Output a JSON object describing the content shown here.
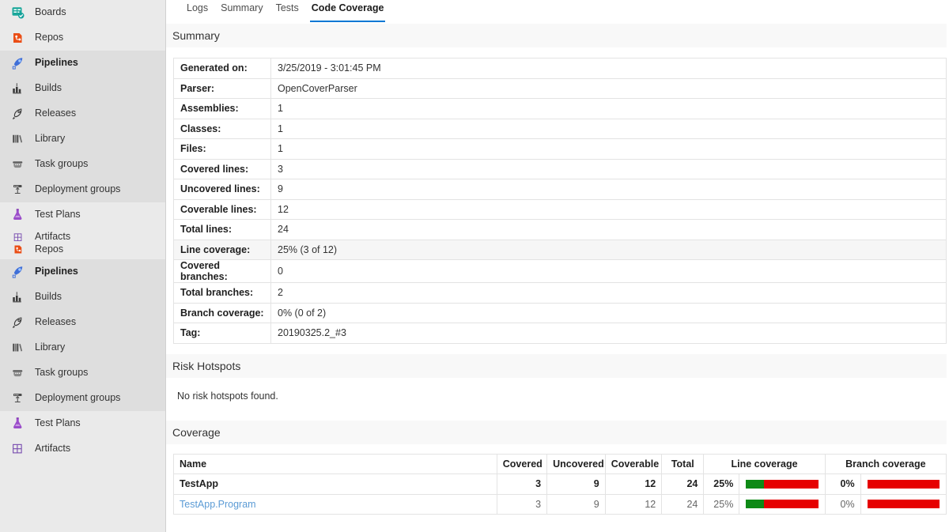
{
  "sidebar": {
    "groups": [
      {
        "active": false,
        "items": [
          {
            "label": "Boards",
            "icon": "boards-icon",
            "bold": false,
            "two_line": false
          }
        ]
      },
      {
        "active": false,
        "items": [
          {
            "label": "Repos",
            "icon": "repos-icon",
            "bold": false,
            "two_line": false
          }
        ]
      },
      {
        "active": true,
        "items": [
          {
            "label": "Pipelines",
            "icon": "pipelines-icon",
            "bold": true,
            "two_line": false
          },
          {
            "label": "Builds",
            "icon": "builds-icon",
            "bold": false,
            "two_line": false
          },
          {
            "label": "Releases",
            "icon": "releases-icon",
            "bold": false,
            "two_line": false
          },
          {
            "label": "Library",
            "icon": "library-icon",
            "bold": false,
            "two_line": false
          },
          {
            "label": "Task groups",
            "icon": "task-groups-icon",
            "bold": false,
            "two_line": false
          },
          {
            "label": "Deployment groups",
            "icon": "deployment-groups-icon",
            "bold": false,
            "two_line": false
          }
        ]
      },
      {
        "active": false,
        "items": [
          {
            "label": "Test Plans",
            "icon": "test-plans-icon",
            "bold": false,
            "two_line": false
          },
          {
            "label": "Artifacts\nRepos",
            "icon": "artifacts-repos-icon",
            "bold": false,
            "two_line": true
          }
        ]
      },
      {
        "active": true,
        "items": [
          {
            "label": "Pipelines",
            "icon": "pipelines-icon",
            "bold": true,
            "two_line": false
          },
          {
            "label": "Builds",
            "icon": "builds-icon",
            "bold": false,
            "two_line": false
          },
          {
            "label": "Releases",
            "icon": "releases-icon",
            "bold": false,
            "two_line": false
          },
          {
            "label": "Library",
            "icon": "library-icon",
            "bold": false,
            "two_line": false
          },
          {
            "label": "Task groups",
            "icon": "task-groups-icon",
            "bold": false,
            "two_line": false
          },
          {
            "label": "Deployment groups",
            "icon": "deployment-groups-icon",
            "bold": false,
            "two_line": false
          }
        ]
      },
      {
        "active": false,
        "items": [
          {
            "label": "Test Plans",
            "icon": "test-plans-icon",
            "bold": false,
            "two_line": false
          },
          {
            "label": "Artifacts",
            "icon": "artifacts-icon",
            "bold": false,
            "two_line": false
          }
        ]
      }
    ]
  },
  "tabs": [
    {
      "label": "Logs",
      "selected": false
    },
    {
      "label": "Summary",
      "selected": false
    },
    {
      "label": "Tests",
      "selected": false
    },
    {
      "label": "Code Coverage",
      "selected": true
    }
  ],
  "sections": {
    "summary_title": "Summary",
    "risk_hotspots_title": "Risk Hotspots",
    "risk_hotspots_note": "No risk hotspots found.",
    "coverage_title": "Coverage"
  },
  "summary_rows": [
    {
      "key": "Generated on:",
      "value": "3/25/2019 - 3:01:45 PM",
      "highlight": false
    },
    {
      "key": "Parser:",
      "value": "OpenCoverParser",
      "highlight": false
    },
    {
      "key": "Assemblies:",
      "value": "1",
      "highlight": false
    },
    {
      "key": "Classes:",
      "value": "1",
      "highlight": false
    },
    {
      "key": "Files:",
      "value": "1",
      "highlight": false
    },
    {
      "key": "Covered lines:",
      "value": "3",
      "highlight": false
    },
    {
      "key": "Uncovered lines:",
      "value": "9",
      "highlight": false
    },
    {
      "key": "Coverable lines:",
      "value": "12",
      "highlight": false
    },
    {
      "key": "Total lines:",
      "value": "24",
      "highlight": false
    },
    {
      "key": "Line coverage:",
      "value": "25% (3 of 12)",
      "highlight": true
    },
    {
      "key": "Covered branches:",
      "value": "0",
      "highlight": false
    },
    {
      "key": "Total branches:",
      "value": "2",
      "highlight": false
    },
    {
      "key": "Branch coverage:",
      "value": "0% (0 of 2)",
      "highlight": false
    },
    {
      "key": "Tag:",
      "value": "20190325.2_#3",
      "highlight": false
    }
  ],
  "coverage_table": {
    "headers": {
      "name": "Name",
      "covered": "Covered",
      "uncovered": "Uncovered",
      "coverable": "Coverable",
      "total": "Total",
      "line_coverage": "Line coverage",
      "branch_coverage": "Branch coverage"
    },
    "rows": [
      {
        "name": "TestApp",
        "is_link": false,
        "bold": true,
        "covered": "3",
        "uncovered": "9",
        "coverable": "12",
        "total": "24",
        "line_pct": "25%",
        "line_pct_value": 25,
        "branch_pct": "0%",
        "branch_pct_value": 0
      },
      {
        "name": "TestApp.Program",
        "is_link": true,
        "bold": false,
        "covered": "3",
        "uncovered": "9",
        "coverable": "12",
        "total": "24",
        "line_pct": "25%",
        "line_pct_value": 25,
        "branch_pct": "0%",
        "branch_pct_value": 0
      }
    ]
  },
  "colors": {
    "accent": "#0078d4",
    "covered_green": "#0e8a16",
    "uncovered_red": "#e60000",
    "link_blue": "#5b9bd5",
    "sidebar_bg": "#eaeaea",
    "sidebar_active_bg": "#dedede"
  }
}
